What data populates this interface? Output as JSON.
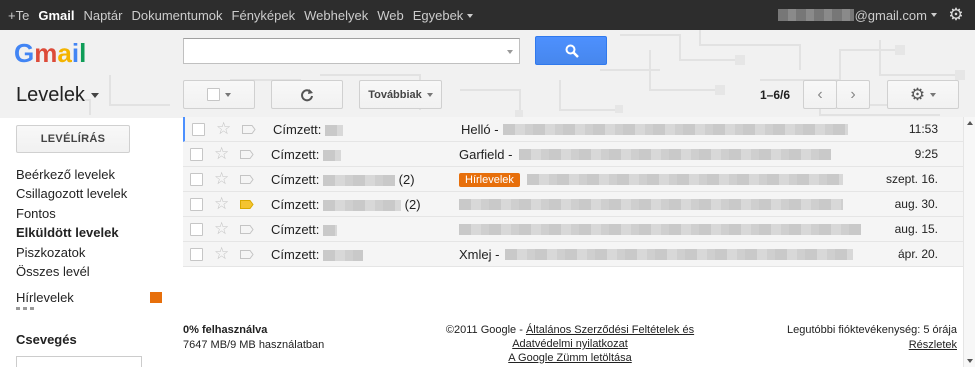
{
  "topnav": {
    "items": [
      {
        "label": "+Te"
      },
      {
        "label": "Gmail"
      },
      {
        "label": "Naptár"
      },
      {
        "label": "Dokumentumok"
      },
      {
        "label": "Fényképek"
      },
      {
        "label": "Webhelyek"
      },
      {
        "label": "Web"
      },
      {
        "label": "Egyebek"
      }
    ],
    "account_suffix": "@gmail.com"
  },
  "header": {
    "logo_text": "Gmail",
    "search_placeholder": "",
    "mail_title": "Levelek"
  },
  "toolbar": {
    "more_label": "Továbbiak",
    "pager": "1–6/6"
  },
  "sidebar": {
    "compose_label": "LEVÉLÍRÁS",
    "items": [
      {
        "label": "Beérkező levelek"
      },
      {
        "label": "Csillagozott levelek"
      },
      {
        "label": "Fontos"
      },
      {
        "label": "Elküldött levelek"
      },
      {
        "label": "Piszkozatok"
      },
      {
        "label": "Összes levél"
      }
    ],
    "label_item": "Hírlevelek",
    "label_color": "#e76f0b",
    "chat_title": "Csevegés"
  },
  "mails": [
    {
      "sender": "Címzett:",
      "count": "",
      "tag": "",
      "subject": "Helló -",
      "date": "11:53",
      "important": false
    },
    {
      "sender": "Címzett:",
      "count": "",
      "tag": "",
      "subject": "Garfield -",
      "date": "9:25",
      "important": false
    },
    {
      "sender": "Címzett:",
      "count": "(2)",
      "tag": "Hírlevelek",
      "subject": "",
      "date": "szept. 16.",
      "important": false
    },
    {
      "sender": "Címzett:",
      "count": "(2)",
      "tag": "",
      "subject": "",
      "date": "aug. 30.",
      "important": true
    },
    {
      "sender": "Címzett:",
      "count": "",
      "tag": "",
      "subject": "",
      "date": "aug. 15.",
      "important": false
    },
    {
      "sender": "Címzett:",
      "count": "",
      "tag": "",
      "subject": "Xmlej -",
      "date": "ápr. 20.",
      "important": false
    }
  ],
  "footer": {
    "usage_percent": "0% felhasználva",
    "usage_detail": "7647 MB/9 MB használatban",
    "copyright": "©2011 Google -",
    "terms_link": "Általános Szerződési Feltételek és",
    "privacy_link": "Adatvédelmi nyilatkozat",
    "download_link": "A Google Zümm letöltása",
    "activity": "Legutóbbi fióktevékenység: 5 órája",
    "details_link": "Részletek"
  },
  "colors": {
    "accent_blue": "#4d90fe",
    "label_orange": "#e76f0b",
    "topbar": "#2d2d2d"
  }
}
